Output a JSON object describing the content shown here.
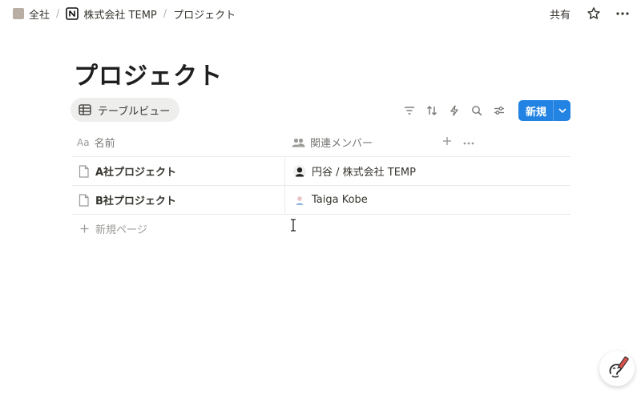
{
  "breadcrumb": {
    "workspace": "全社",
    "company": "株式会社 TEMP",
    "page": "プロジェクト"
  },
  "topbar": {
    "share_label": "共有"
  },
  "page": {
    "title": "プロジェクト"
  },
  "view": {
    "tab_label": "テーブルビュー"
  },
  "toolbar": {
    "new_label": "新規",
    "accent_color": "#2383e2"
  },
  "table": {
    "columns": [
      {
        "label": "名前",
        "icon": "text-property-icon"
      },
      {
        "label": "関連メンバー",
        "icon": "people-icon"
      }
    ],
    "rows": [
      {
        "name": "A社プロジェクト",
        "member": "円谷 / 株式会社 TEMP"
      },
      {
        "name": "B社プロジェクト",
        "member": "Taiga Kobe"
      }
    ],
    "new_page_label": "新規ページ"
  }
}
